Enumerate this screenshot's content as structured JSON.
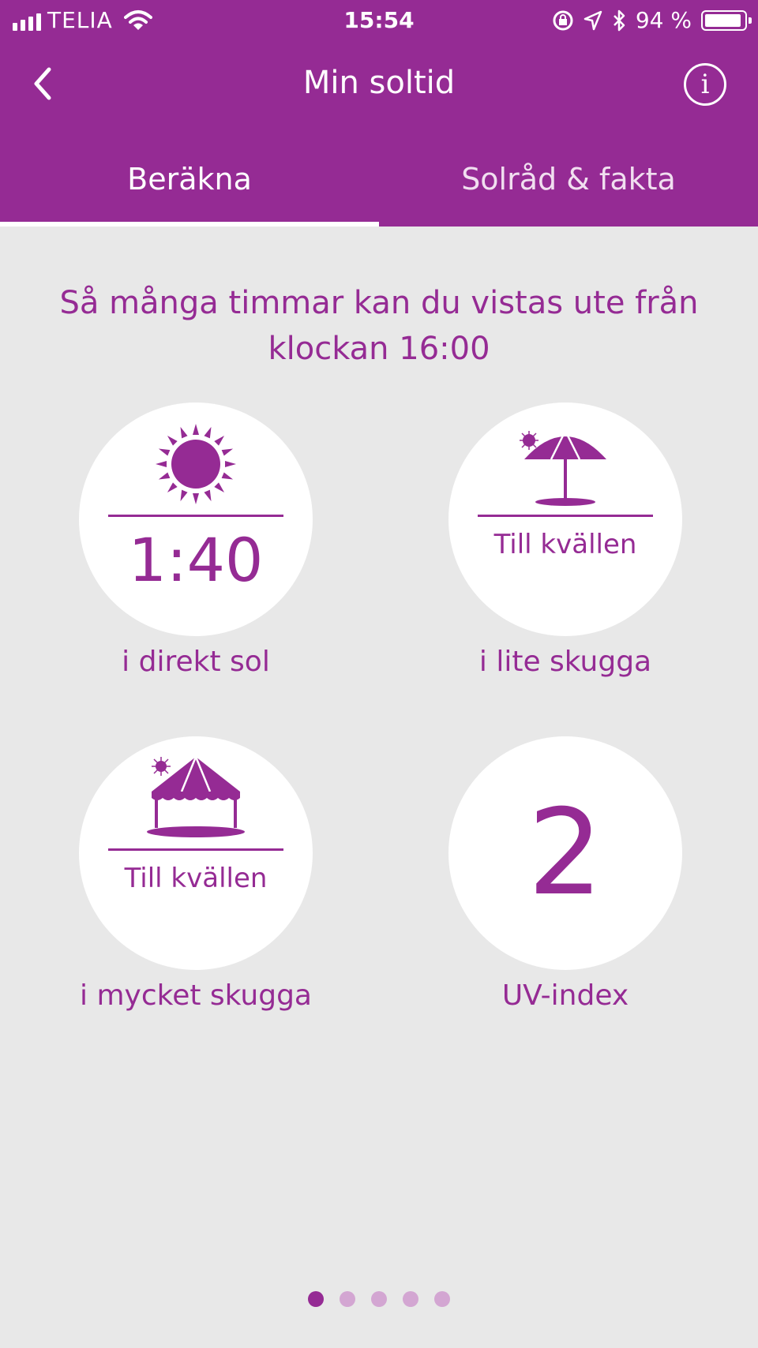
{
  "status_bar": {
    "carrier": "TELIA",
    "time": "15:54",
    "battery": "94 %",
    "battery_level": 0.94,
    "icons": [
      "signal-icon",
      "wifi-icon",
      "orientation-lock-icon",
      "location-arrow-icon",
      "bluetooth-icon",
      "battery-icon"
    ]
  },
  "nav": {
    "title": "Min soltid",
    "back_icon": "chevron-left-icon",
    "info_label": "i"
  },
  "tabs": [
    {
      "label": "Beräkna",
      "active": true
    },
    {
      "label": "Solråd & fakta",
      "active": false
    }
  ],
  "headline": "Så många timmar kan du vistas ute från klockan 16:00",
  "cards": {
    "direct_sun": {
      "icon": "sun-icon",
      "value": "1:40",
      "caption": "i direkt sol"
    },
    "little_shade": {
      "icon": "parasol-icon",
      "value": "Till kvällen",
      "caption": "i lite skugga"
    },
    "much_shade": {
      "icon": "pavilion-icon",
      "value": "Till kvällen",
      "caption": "i mycket skugga"
    },
    "uv_index": {
      "value": "2",
      "caption": "UV-index"
    }
  },
  "pagination": {
    "total": 5,
    "active_index": 0
  },
  "colors": {
    "brand": "#952b94",
    "background": "#e8e8e8",
    "dot_inactive": "#d3a6d2"
  }
}
